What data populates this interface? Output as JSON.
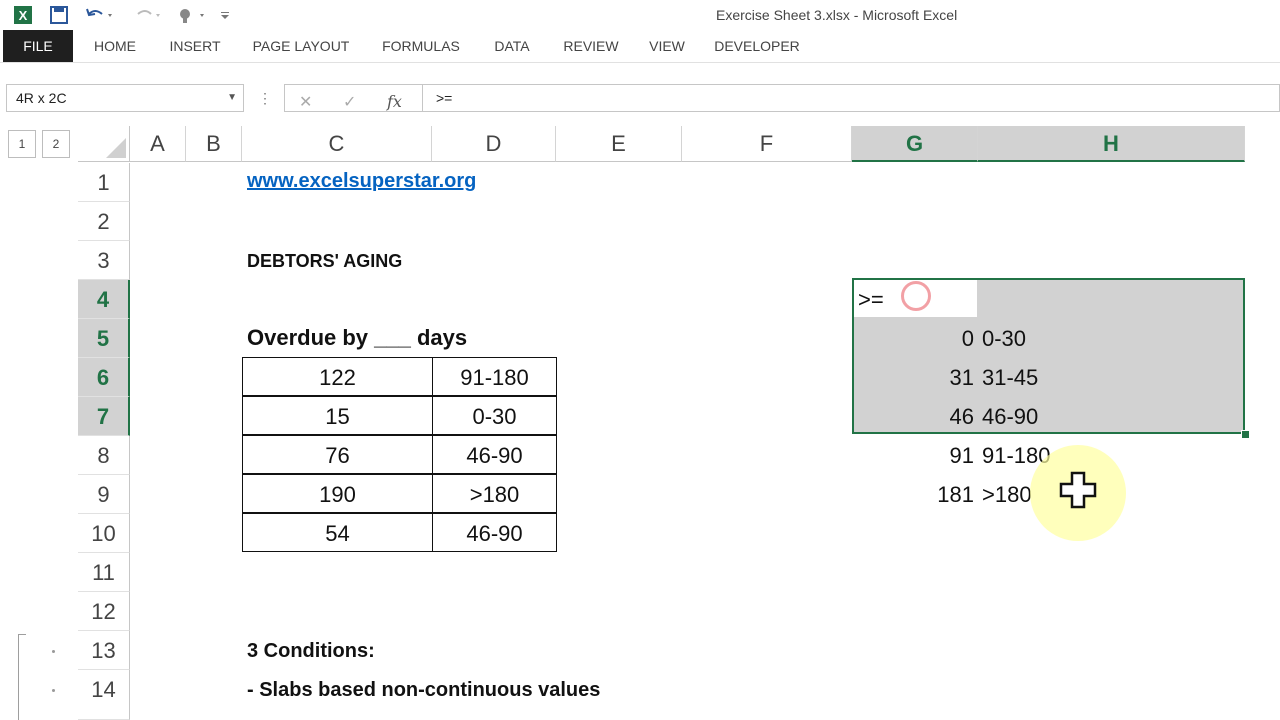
{
  "window": {
    "title": "Exercise Sheet 3.xlsx - Microsoft Excel"
  },
  "ribbon": {
    "tabs": [
      "FILE",
      "HOME",
      "INSERT",
      "PAGE LAYOUT",
      "FORMULAS",
      "DATA",
      "REVIEW",
      "VIEW",
      "DEVELOPER"
    ]
  },
  "formula_bar": {
    "name_box": "4R x 2C",
    "formula": ">="
  },
  "outline": {
    "levels": [
      "1",
      "2"
    ]
  },
  "columns": [
    "A",
    "B",
    "C",
    "D",
    "E",
    "F",
    "G",
    "H"
  ],
  "rows": [
    "1",
    "2",
    "3",
    "4",
    "5",
    "6",
    "7",
    "8",
    "9",
    "10",
    "11",
    "12",
    "13",
    "14"
  ],
  "sheet": {
    "link": "www.excelsuperstar.org",
    "heading": "DEBTORS' AGING",
    "table_title": "Overdue by ___ days",
    "table": [
      {
        "days": "122",
        "slab": "91-180"
      },
      {
        "days": "15",
        "slab": "0-30"
      },
      {
        "days": "76",
        "slab": "46-90"
      },
      {
        "days": "190",
        "slab": ">180"
      },
      {
        "days": "54",
        "slab": "46-90"
      }
    ],
    "lookup_header": ">=",
    "lookup": [
      {
        "from": "0",
        "slab": "0-30"
      },
      {
        "from": "31",
        "slab": "31-45"
      },
      {
        "from": "46",
        "slab": "46-90"
      },
      {
        "from": "91",
        "slab": "91-180"
      },
      {
        "from": "181",
        "slab": ">180"
      }
    ],
    "conditions_title": "3 Conditions:",
    "condition_1": "- Slabs based non-continuous values"
  },
  "colors": {
    "excel_green": "#217346",
    "link_blue": "#0563c1",
    "selection_gray": "#d2d2d2"
  }
}
